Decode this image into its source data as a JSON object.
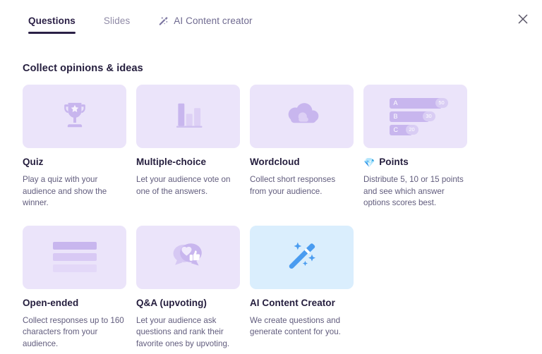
{
  "window": {
    "close_label": "×",
    "close_icon": "close-icon"
  },
  "tabs": [
    {
      "label": "Questions",
      "state": "active",
      "icon": null
    },
    {
      "label": "Slides",
      "state": "inactive",
      "icon": null
    },
    {
      "label": "AI Content creator",
      "state": "ai",
      "icon": "magic-wand-icon"
    }
  ],
  "section": {
    "title": "Collect opinions & ideas"
  },
  "cards": [
    {
      "id": "quiz",
      "title": "Quiz",
      "description": "Play a quiz with your audience and show the winner.",
      "icon": "trophy-icon",
      "badge": null,
      "theme": "purple"
    },
    {
      "id": "multiple-choice",
      "title": "Multiple-choice",
      "description": "Let your audience vote on one of the answers.",
      "icon": "bar-chart-icon",
      "badge": null,
      "theme": "purple"
    },
    {
      "id": "wordcloud",
      "title": "Wordcloud",
      "description": "Collect short responses from your audience.",
      "icon": "cloud-icon",
      "badge": null,
      "theme": "purple"
    },
    {
      "id": "points",
      "title": "Points",
      "description": "Distribute 5, 10 or 15 points and see which answer options scores best.",
      "icon": "points-bars-icon",
      "badge": "💎",
      "theme": "purple",
      "bars": [
        {
          "letter": "A",
          "value": "50",
          "width": 74
        },
        {
          "letter": "B",
          "value": "30",
          "width": 56
        },
        {
          "letter": "C",
          "value": "20",
          "width": 32
        }
      ]
    },
    {
      "id": "open-ended",
      "title": "Open-ended",
      "description": "Collect responses up to 160 characters from your audience.",
      "icon": "text-lines-icon",
      "badge": null,
      "theme": "purple"
    },
    {
      "id": "qa-upvoting",
      "title": "Q&A (upvoting)",
      "description": "Let your audience ask questions and rank their favorite ones by upvoting.",
      "icon": "speech-bubbles-icon",
      "badge": null,
      "theme": "purple"
    },
    {
      "id": "ai-content-creator",
      "title": "AI Content Creator",
      "description": "We create questions and generate content for you.",
      "icon": "magic-wand-icon",
      "badge": null,
      "theme": "blue"
    }
  ],
  "colors": {
    "thumb_purple": "#ebe4fa",
    "thumb_blue": "#daeefd",
    "icon_purple": "#c8b6ee",
    "icon_purple_light": "#ddd0f5",
    "icon_blue": "#4a9cf0",
    "tab_active": "#2b2046",
    "tab_inactive": "#8f8aa6",
    "title": "#241d3d",
    "body": "#615c7d"
  }
}
